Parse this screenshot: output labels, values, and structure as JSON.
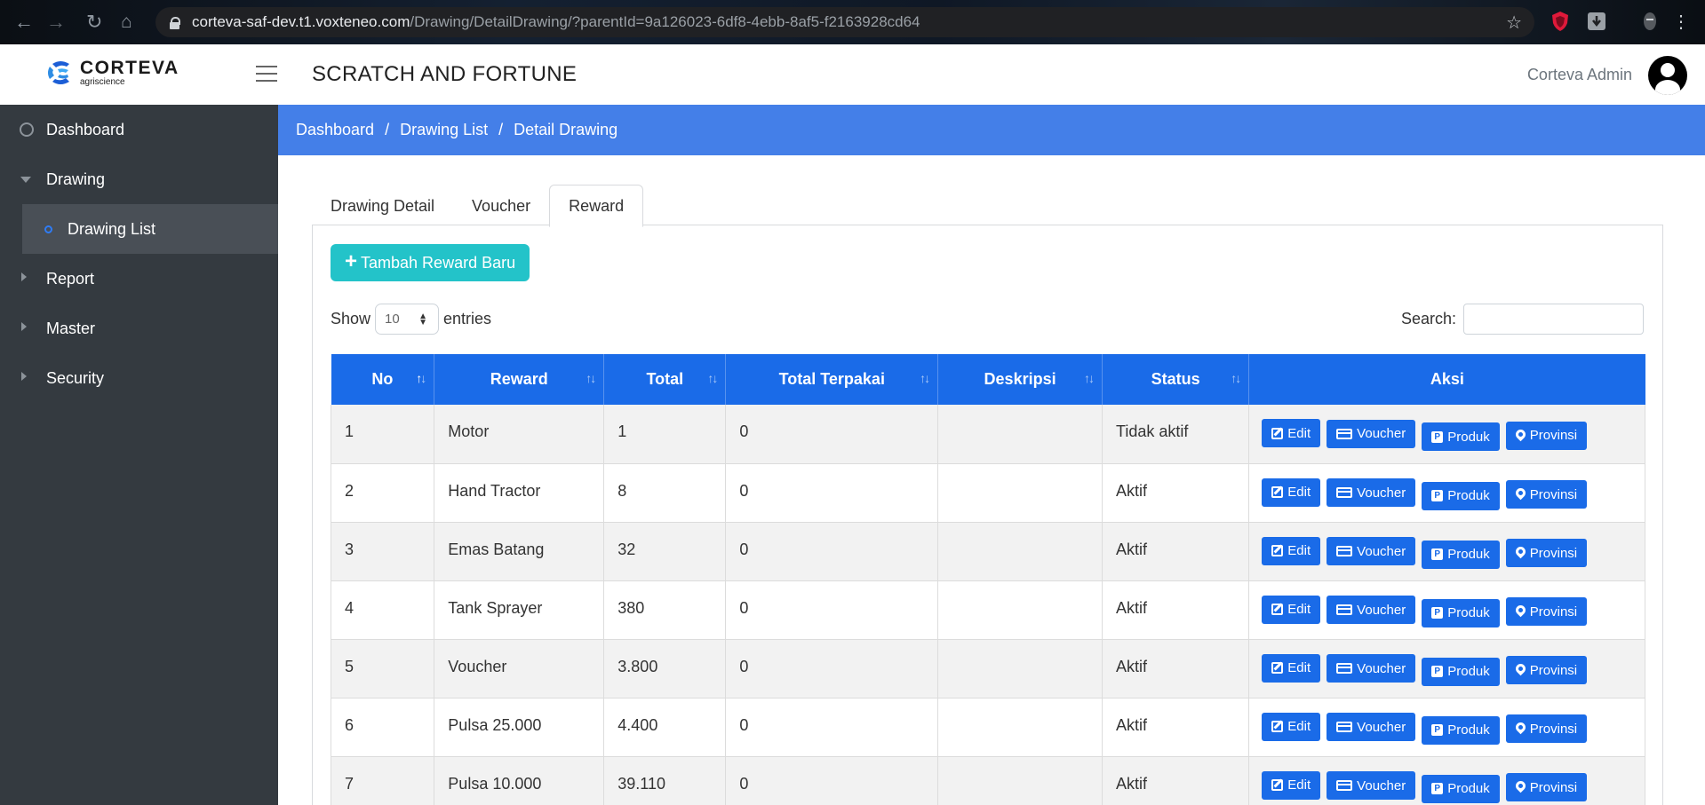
{
  "browser": {
    "url_host": "corteva-saf-dev.t1.voxteneo.com",
    "url_path": "/Drawing/DetailDrawing/?parentId=9a126023-6df8-4ebb-8af5-f2163928cd64"
  },
  "header": {
    "logo_name": "CORTEVA",
    "logo_sub": "agriscience",
    "app_title": "SCRATCH AND FORTUNE",
    "user_name": "Corteva Admin"
  },
  "sidebar": {
    "items": [
      {
        "label": "Dashboard",
        "icon": "dashboard-gauge-icon"
      },
      {
        "label": "Drawing",
        "icon": "caret-down-icon"
      },
      {
        "label": "Drawing List",
        "icon": "circle-icon"
      },
      {
        "label": "Report",
        "icon": "caret-right-icon"
      },
      {
        "label": "Master",
        "icon": "caret-right-icon"
      },
      {
        "label": "Security",
        "icon": "caret-right-icon"
      }
    ]
  },
  "breadcrumb": {
    "items": [
      "Dashboard",
      "Drawing List",
      "Detail Drawing"
    ],
    "separator": "/"
  },
  "tabs": [
    "Drawing Detail",
    "Voucher",
    "Reward"
  ],
  "active_tab": "Reward",
  "toolbar": {
    "add_label": "Tambah Reward Baru",
    "show_label": "Show",
    "entries_label": "entries",
    "page_size": "10",
    "search_label": "Search:"
  },
  "table": {
    "headers": [
      "No",
      "Reward",
      "Total",
      "Total Terpakai",
      "Deskripsi",
      "Status",
      "Aksi"
    ],
    "rows": [
      [
        "1",
        "Motor",
        "1",
        "0",
        "",
        "Tidak aktif"
      ],
      [
        "2",
        "Hand Tractor",
        "8",
        "0",
        "",
        "Aktif"
      ],
      [
        "3",
        "Emas Batang",
        "32",
        "0",
        "",
        "Aktif"
      ],
      [
        "4",
        "Tank Sprayer",
        "380",
        "0",
        "",
        "Aktif"
      ],
      [
        "5",
        "Voucher",
        "3.800",
        "0",
        "",
        "Aktif"
      ],
      [
        "6",
        "Pulsa 25.000",
        "4.400",
        "0",
        "",
        "Aktif"
      ],
      [
        "7",
        "Pulsa 10.000",
        "39.110",
        "0",
        "",
        "Aktif"
      ]
    ],
    "actions": [
      "Edit",
      "Voucher",
      "Produk",
      "Provinsi"
    ]
  },
  "colors": {
    "sidebar_bg": "#343a40",
    "breadcrumb_bg": "#447fe8",
    "table_header_bg": "#1a6be8",
    "add_button_bg": "#23c3c9",
    "action_button_bg": "#1a6be8"
  }
}
